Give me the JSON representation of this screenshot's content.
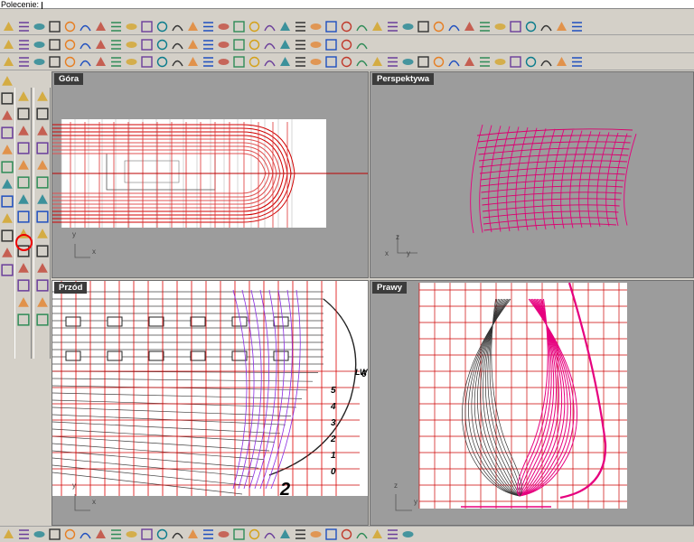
{
  "command": {
    "label": "Polecenie:",
    "value": ""
  },
  "viewports": {
    "top": {
      "title": "Góra"
    },
    "perspective": {
      "title": "Perspektywa"
    },
    "front": {
      "title": "Przód"
    },
    "right": {
      "title": "Prawy"
    }
  },
  "axes": {
    "x": "x",
    "y": "y",
    "z": "z"
  },
  "blueprint_labels": {
    "waterline": "LW",
    "numbers": [
      "6",
      "5",
      "4",
      "3",
      "2",
      "1",
      "0"
    ],
    "sheet_number": "2"
  },
  "toolbar_buttons": {
    "row1": [
      "new-icon",
      "open-icon",
      "save-icon",
      "print-icon",
      "import-icon",
      "cut-icon",
      "copy-icon",
      "paste-icon",
      "undo-icon",
      "pan-icon",
      "rotate-icon",
      "zoom-icon",
      "zoom-window-icon",
      "zoom-extents-icon",
      "zoom-selected-icon",
      "redo-view-icon",
      "viewport-layout-icon",
      "car-icon",
      "hide-icon",
      "sphere-view-icon",
      "snap-icon",
      "light-icon",
      "lock-icon",
      "layer-icon",
      "color-icon",
      "render-icon",
      "material-icon",
      "render-preview-icon",
      "sphere-icon",
      "select-icon",
      "options-icon",
      "grid-icon",
      "help-icon",
      "plugin-icon",
      "dimension-icon",
      "analyze-icon",
      "texture-icon",
      "person-icon"
    ],
    "row2": [
      "point-icon",
      "line-icon",
      "curve-icon",
      "polyline-icon",
      "arc-icon",
      "circle-icon",
      "ellipse-icon",
      "rectangle-icon",
      "polygon-icon",
      "freeform-icon",
      "spline-icon",
      "fillet-icon",
      "chamfer-icon",
      "offset-icon",
      "extend-icon",
      "trim-icon",
      "split-icon",
      "join-icon",
      "explode-icon",
      "group-icon",
      "ungroup-icon",
      "block-icon",
      "array-icon",
      "mirror-icon"
    ],
    "row3": [
      "surface-icon",
      "loft-icon",
      "sweep1-icon",
      "sweep2-icon",
      "revolve-icon",
      "extrude-icon",
      "network-icon",
      "patch-icon",
      "edge-surface-icon",
      "planar-icon",
      "blend-icon",
      "fit-icon",
      "deg-icon",
      "rebuild-icon",
      "untrim-icon",
      "match-icon",
      "merge-icon",
      "flip-icon",
      "unroll-icon",
      "project-icon",
      "silhouette-icon",
      "contour-icon",
      "section-icon",
      "isocurve-icon",
      "curvature-icon",
      "zebra-icon",
      "environment-icon",
      "draft-icon",
      "edge-icon",
      "naked-edge-icon",
      "check-icon",
      "boundary-icon",
      "solid-icon",
      "box-icon",
      "cylinder-icon",
      "cone-icon",
      "torus-icon",
      "pipe-icon"
    ],
    "bottom": [
      "curve-tools-icon",
      "fillet-curves-icon",
      "blend-curves-icon",
      "offset-curve-icon",
      "chamfer-curves-icon",
      "fit-curve-icon",
      "rebuild-curve-icon",
      "change-degree-icon",
      "match-curve-icon",
      "adjust-seam-icon",
      "fair-icon",
      "simplify-icon",
      "refit-icon",
      "close-curve-icon",
      "extend-curve-icon",
      "trim-curve-icon",
      "points-on-icon",
      "points-off-icon",
      "edit-points-icon",
      "insert-knot-icon",
      "remove-knot-icon",
      "split-curve-icon",
      "join-curve-icon",
      "symmetric-icon",
      "curve-from-2-views-icon",
      "curve-network-icon",
      "end-icon"
    ]
  }
}
